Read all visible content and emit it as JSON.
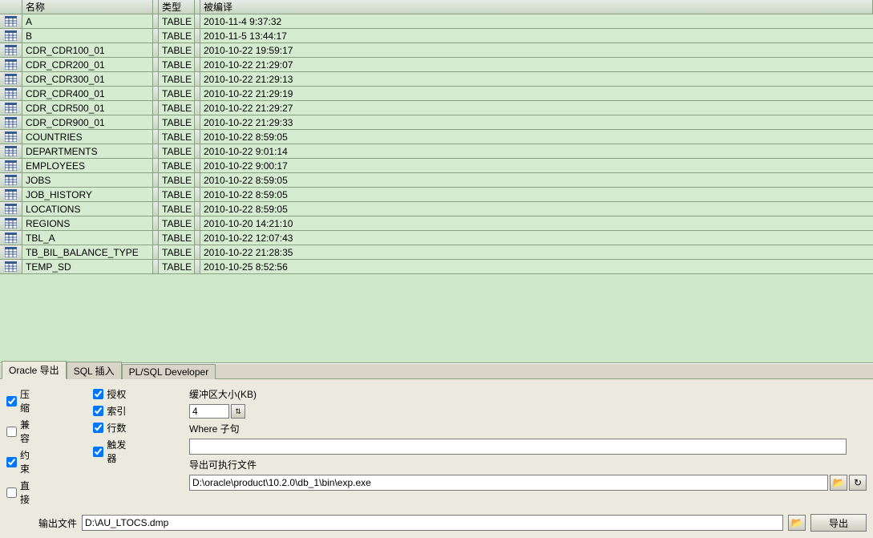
{
  "grid": {
    "headers": {
      "name": "名称",
      "type": "类型",
      "compiled": "被编译"
    },
    "rows": [
      {
        "name": "A",
        "type": "TABLE",
        "date": "2010-11-4 9:37:32"
      },
      {
        "name": "B",
        "type": "TABLE",
        "date": "2010-11-5 13:44:17"
      },
      {
        "name": "CDR_CDR100_01",
        "type": "TABLE",
        "date": "2010-10-22 19:59:17"
      },
      {
        "name": "CDR_CDR200_01",
        "type": "TABLE",
        "date": "2010-10-22 21:29:07"
      },
      {
        "name": "CDR_CDR300_01",
        "type": "TABLE",
        "date": "2010-10-22 21:29:13"
      },
      {
        "name": "CDR_CDR400_01",
        "type": "TABLE",
        "date": "2010-10-22 21:29:19"
      },
      {
        "name": "CDR_CDR500_01",
        "type": "TABLE",
        "date": "2010-10-22 21:29:27"
      },
      {
        "name": "CDR_CDR900_01",
        "type": "TABLE",
        "date": "2010-10-22 21:29:33"
      },
      {
        "name": "COUNTRIES",
        "type": "TABLE",
        "date": "2010-10-22 8:59:05"
      },
      {
        "name": "DEPARTMENTS",
        "type": "TABLE",
        "date": "2010-10-22 9:01:14"
      },
      {
        "name": "EMPLOYEES",
        "type": "TABLE",
        "date": "2010-10-22 9:00:17"
      },
      {
        "name": "JOBS",
        "type": "TABLE",
        "date": "2010-10-22 8:59:05"
      },
      {
        "name": "JOB_HISTORY",
        "type": "TABLE",
        "date": "2010-10-22 8:59:05"
      },
      {
        "name": "LOCATIONS",
        "type": "TABLE",
        "date": "2010-10-22 8:59:05"
      },
      {
        "name": "REGIONS",
        "type": "TABLE",
        "date": "2010-10-20 14:21:10"
      },
      {
        "name": "TBL_A",
        "type": "TABLE",
        "date": "2010-10-22 12:07:43"
      },
      {
        "name": "TB_BIL_BALANCE_TYPE",
        "type": "TABLE",
        "date": "2010-10-22 21:28:35"
      },
      {
        "name": "TEMP_SD",
        "type": "TABLE",
        "date": "2010-10-25 8:52:56"
      }
    ]
  },
  "tabs": [
    {
      "label": "Oracle 导出",
      "active": true
    },
    {
      "label": "SQL 插入",
      "active": false
    },
    {
      "label": "PL/SQL Developer",
      "active": false
    }
  ],
  "options": {
    "left": [
      {
        "label": "压缩",
        "checked": true
      },
      {
        "label": "兼容",
        "checked": false
      },
      {
        "label": "约束",
        "checked": true
      },
      {
        "label": "直接",
        "checked": false
      }
    ],
    "right": [
      {
        "label": "授权",
        "checked": true
      },
      {
        "label": "索引",
        "checked": true
      },
      {
        "label": "行数",
        "checked": true
      },
      {
        "label": "触发器",
        "checked": true
      }
    ]
  },
  "fields": {
    "buffer_label": "缓冲区大小(KB)",
    "buffer_value": "4",
    "where_label": "Where 子句",
    "where_value": "",
    "exe_label": "导出可执行文件",
    "exe_value": "D:\\oracle\\product\\10.2.0\\db_1\\bin\\exp.exe",
    "output_label": "输出文件",
    "output_value": "D:\\AU_LTOCS.dmp",
    "export_btn": "导出"
  },
  "icons": {
    "folder": "📂",
    "refresh": "↻",
    "spinner": "⇅"
  }
}
